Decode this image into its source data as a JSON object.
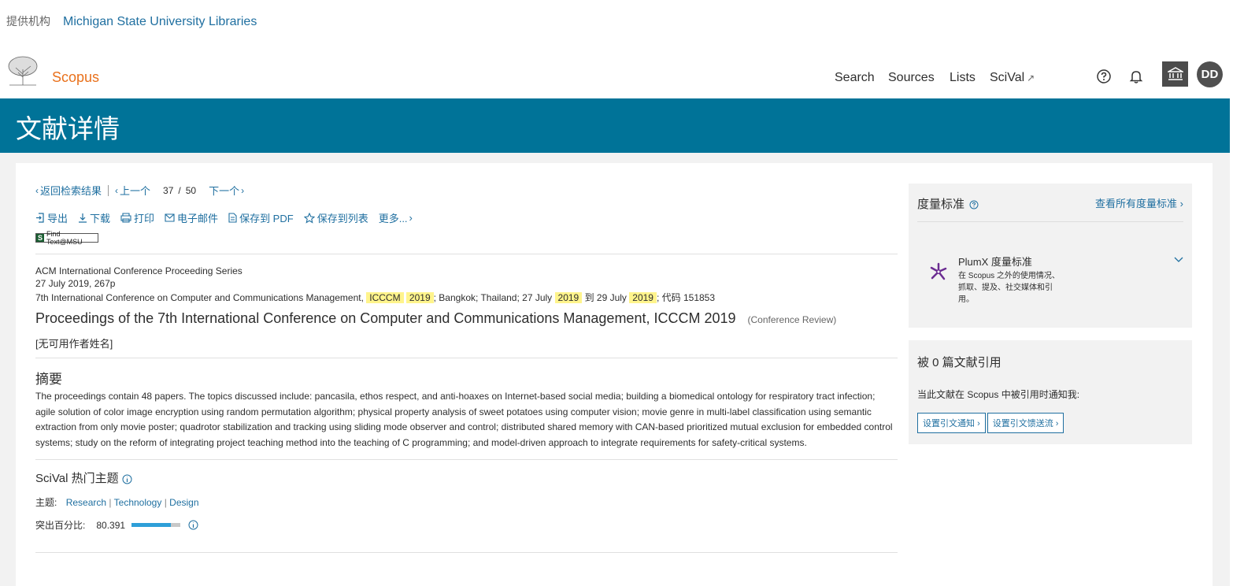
{
  "institution": {
    "label": "提供机构",
    "name": "Michigan State University Libraries"
  },
  "brand": "Scopus",
  "nav": {
    "search": "Search",
    "sources": "Sources",
    "lists": "Lists",
    "scival": "SciVal",
    "scival_ext": "↗"
  },
  "user": {
    "initials": "DD"
  },
  "banner": {
    "title": "文献详情"
  },
  "navigation": {
    "back": "返回检索结果",
    "prev": "上一个",
    "position": "37",
    "sep": "/",
    "total": "50",
    "next": "下一个"
  },
  "actions": {
    "export": "导出",
    "download": "下载",
    "print": "打印",
    "email": "电子邮件",
    "save_pdf": "保存到 PDF",
    "save_list": "保存到列表",
    "more": "更多..."
  },
  "findtext": {
    "s": "S",
    "label": "Find Text@MSU"
  },
  "doc": {
    "series": "ACM International Conference Proceeding Series",
    "date_pages": "27 July 2019, 267p",
    "conf_prefix": "7th International Conference on Computer and Communications Management,",
    "conf_hl1": "ICCCM",
    "conf_hl2": "2019",
    "conf_mid": "; Bangkok; Thailand; 27 July",
    "conf_hl3": "2019",
    "conf_to": "到 29 July",
    "conf_hl4": "2019",
    "conf_suffix": "; 代码 151853",
    "title": "Proceedings of the 7th International Conference on Computer and Communications Management, ICCCM 2019",
    "doc_type": "(Conference Review)",
    "authors": "[无可用作者姓名]"
  },
  "abstract": {
    "heading": "摘要",
    "text": "The proceedings contain 48 papers. The topics discussed include: pancasila, ethos respect, and anti-hoaxes on Internet-based social media; building a biomedical ontology for respiratory tract infection; agile solution of color image encryption using random permutation algorithm; physical property analysis of sweet potatoes using computer vision; movie genre in multi-label classification using semantic extraction from only movie poster; quadrotor stabilization and tracking using sliding mode observer and control; distributed shared memory with CAN-based prioritized mutual exclusion for embedded control systems; study on the reform of integrating project teaching method into the teaching of C programming; and model-driven approach to integrate requirements for safety-critical systems."
  },
  "scival": {
    "heading": "SciVal 热门主题",
    "topic_label": "主题:",
    "topics": [
      "Research",
      "Technology",
      "Design"
    ],
    "topic_sep": "|",
    "prominence_label": "突出百分比:",
    "prominence_value": "80.391",
    "prominence_fraction": 0.80391
  },
  "metrics": {
    "heading": "度量标准",
    "view_all": "查看所有度量标准",
    "plumx_title": "PlumX 度量标准",
    "plumx_desc1": "在 Scopus 之外的使用情况、",
    "plumx_desc2": "抓取、提及、社交媒体和引",
    "plumx_desc3": "用。"
  },
  "citations": {
    "heading": "被 0 篇文献引用",
    "notify": "当此文献在 Scopus 中被引用时通知我:",
    "alert_btn": "设置引文通知",
    "feed_btn": "设置引文馈送流"
  },
  "colors": {
    "teal": "#007398",
    "link": "#1f6fa0",
    "orange": "#e9711c",
    "highlight": "#fff48c",
    "meter": "#2e9fd8"
  }
}
